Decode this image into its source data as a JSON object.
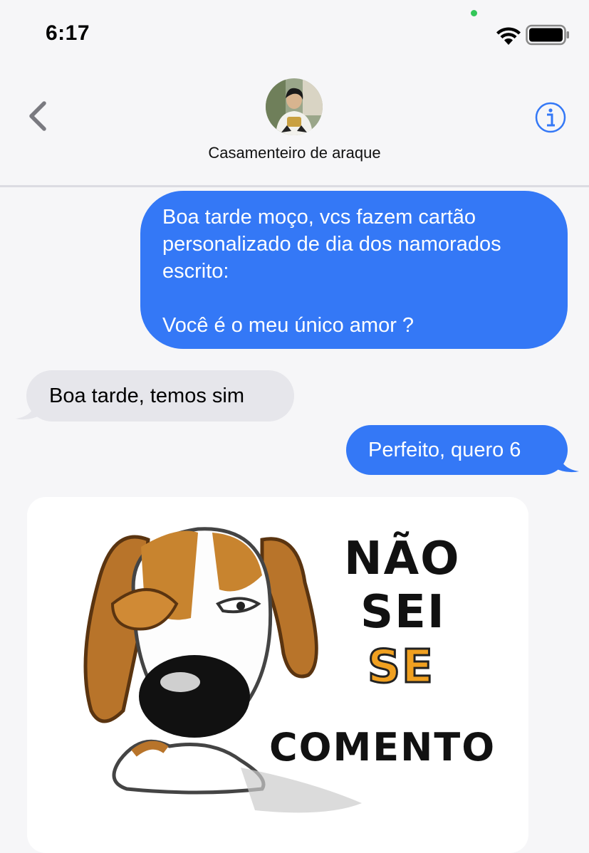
{
  "status_bar": {
    "time": "6:17"
  },
  "header": {
    "contact_name": "Casamenteiro de araque"
  },
  "messages": [
    {
      "side": "sent",
      "text": "Boa tarde moço, vcs fazem cartão\npersonalizado de dia dos namorados\nescrito:\n\nVocê é o meu único amor ?"
    },
    {
      "side": "received",
      "text": "Boa tarde, temos sim"
    },
    {
      "side": "sent",
      "text": "Perfeito, quero 6"
    }
  ],
  "sticker": {
    "lines": [
      "NÃO",
      "SEI",
      "SE",
      "COMENTO"
    ]
  },
  "colors": {
    "sent_bubble": "#3478f6",
    "received_bubble": "#e6e6eb",
    "accent": "#3478f6"
  }
}
